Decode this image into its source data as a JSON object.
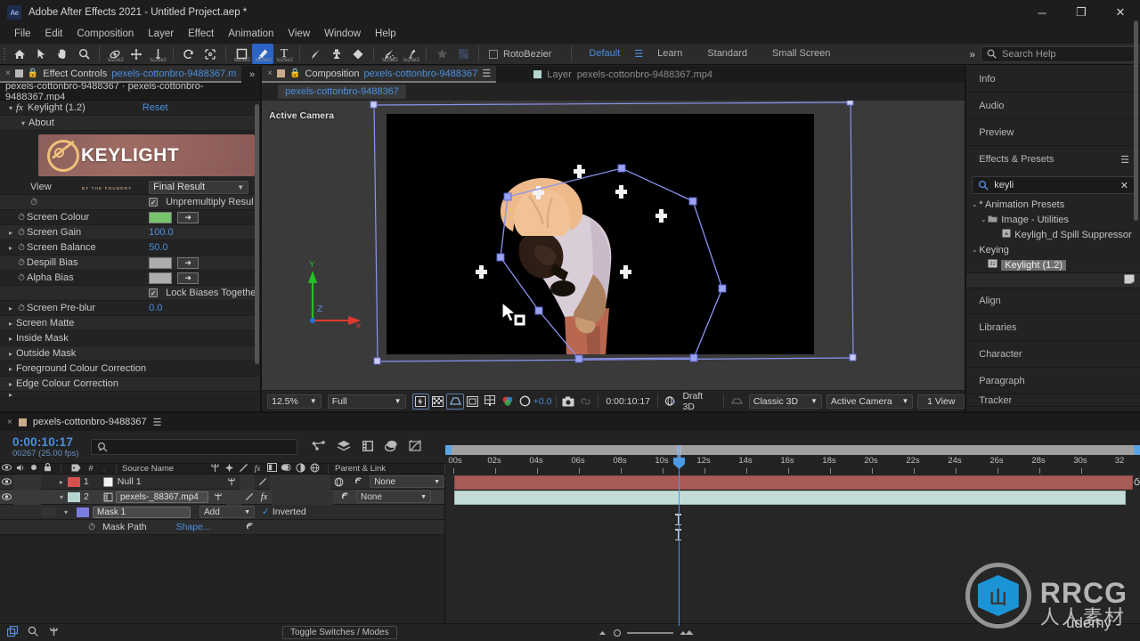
{
  "titlebar": {
    "logo": "Ae",
    "title": "Adobe After Effects 2021 - Untitled Project.aep *",
    "minimize": "─",
    "maximize": "❐",
    "close": "✕"
  },
  "menubar": {
    "items": [
      "File",
      "Edit",
      "Composition",
      "Layer",
      "Effect",
      "Animation",
      "View",
      "Window",
      "Help"
    ]
  },
  "toolbar": {
    "tools": [
      {
        "name": "home-icon",
        "glyph": "⌂"
      },
      {
        "name": "selection-tool",
        "glyph": "➤"
      },
      {
        "name": "hand-tool",
        "glyph": "✋"
      },
      {
        "name": "zoom-tool",
        "glyph": "⚲"
      },
      {
        "name": "orbit-tool",
        "glyph": "↻"
      },
      {
        "name": "pan-behind-tool",
        "glyph": "✥"
      },
      {
        "name": "dolly-tool",
        "glyph": "↓"
      },
      {
        "name": "rotation-tool",
        "glyph": "↺"
      },
      {
        "name": "anchor-point-tool",
        "glyph": "⬚"
      },
      {
        "name": "shape-tool",
        "glyph": "■"
      },
      {
        "name": "pen-tool",
        "glyph": "✒"
      },
      {
        "name": "type-tool",
        "glyph": "T"
      },
      {
        "name": "brush-tool",
        "glyph": "╱"
      },
      {
        "name": "clone-stamp-tool",
        "glyph": "⚓"
      },
      {
        "name": "eraser-tool",
        "glyph": "◆"
      },
      {
        "name": "roto-brush-tool",
        "glyph": "✐"
      },
      {
        "name": "puppet-pin-tool",
        "glyph": "✦"
      }
    ],
    "rotobezier_label": "RotoBezier",
    "workspaces": [
      "Default",
      "Learn",
      "Standard",
      "Small Screen"
    ],
    "workspace_selected": "Default",
    "chevron": "»",
    "search_help_placeholder": "Search Help",
    "search_icon": "search-icon"
  },
  "effect_controls": {
    "tab_label": "Effect Controls",
    "tab_file": "pexels-cottonbro-9488367.m",
    "subtitle": "pexels-cottonbro-9488367 · pexels-cottonbro-9488367.mp4",
    "more_chevron": "»",
    "effect_name": "Keylight (1.2)",
    "reset_label": "Reset",
    "about_label": "About",
    "banner_word": "KEYLIGHT",
    "banner_sub": "BY THE FOUNDRY",
    "rows": [
      {
        "label": "View",
        "type": "select",
        "value": "Final Result"
      },
      {
        "label": "",
        "type": "checkbox",
        "value": "Unpremultiply Resul",
        "checked": true
      },
      {
        "label": "Screen Colour",
        "type": "colorswatch",
        "color": "#77c46c"
      },
      {
        "label": "Screen Gain",
        "type": "number",
        "value": "100.0",
        "expandable": true
      },
      {
        "label": "Screen Balance",
        "type": "number",
        "value": "50.0",
        "expandable": true
      },
      {
        "label": "Despill Bias",
        "type": "colorswatch",
        "color": "#adadad"
      },
      {
        "label": "Alpha Bias",
        "type": "colorswatch",
        "color": "#adadad"
      },
      {
        "label": "",
        "type": "checkbox",
        "value": "Lock Biases Togethe",
        "checked": true
      },
      {
        "label": "Screen Pre-blur",
        "type": "number",
        "value": "0.0",
        "expandable": true
      },
      {
        "label": "Screen Matte",
        "type": "group"
      },
      {
        "label": "Inside Mask",
        "type": "group"
      },
      {
        "label": "Outside Mask",
        "type": "group"
      },
      {
        "label": "Foreground Colour Correction",
        "type": "group"
      },
      {
        "label": "Edge Colour Correction",
        "type": "group"
      }
    ]
  },
  "composition": {
    "tab_label": "Composition",
    "tab_file": "pexels-cottonbro-9488367",
    "layer_tab_label": "Layer",
    "layer_tab_file": "pexels-cottonbro-9488367.mp4",
    "comp_name_chip": "pexels-cottonbro-9488367",
    "active_camera_label": "Active Camera",
    "axis_x": "X",
    "axis_y": "Y",
    "axis_z": "Z",
    "bottom_bar": {
      "zoom": "12.5%",
      "resolution": "Full",
      "exposure": "+0.0",
      "timecode": "0:00:10:17",
      "draft3d": "Draft 3D",
      "renderer": "Classic 3D",
      "camera": "Active Camera",
      "views": "1 View"
    }
  },
  "right_panels": {
    "items": [
      "Info",
      "Audio",
      "Preview"
    ],
    "effects_presets_title": "Effects & Presets",
    "burger": "☰",
    "search_value": "keyli",
    "clear_icon": "✕",
    "tree": [
      {
        "depth": 0,
        "twirl": "⌄",
        "label": "* Animation Presets",
        "icon": null,
        "selected": false
      },
      {
        "depth": 1,
        "twirl": "⌄",
        "label": "Image - Utilities",
        "icon": "folder-icon",
        "selected": false
      },
      {
        "depth": 2,
        "twirl": "",
        "label": "Keyligh_d Spill Suppressor",
        "icon": "preset-icon",
        "selected": false
      },
      {
        "depth": 0,
        "twirl": "⌄",
        "label": "Keying",
        "icon": null,
        "selected": false
      },
      {
        "depth": 1,
        "twirl": "",
        "label": "Keylight (1.2)",
        "icon": "effect-32bit-icon",
        "selected": true
      }
    ],
    "bottom_items": [
      "Align",
      "Libraries",
      "Character",
      "Paragraph",
      "Tracker"
    ]
  },
  "timeline": {
    "tab_name": "pexels-cottonbro-9488367",
    "burger": "☰",
    "current_time": "0:00:10:17",
    "frame_info": "00267 (25.00 fps)",
    "search_icon": "search-icon",
    "search_value": "",
    "column_headers": {
      "video": "◉",
      "audio": "◑",
      "solo": "●",
      "lock": "ὑ2",
      "label": "label-icon",
      "num": "#",
      "source_name": "Source Name",
      "switches": "▣",
      "parent_link": "Parent & Link"
    },
    "layers": [
      {
        "index": "1",
        "name": "Null 1",
        "label_color": "#d4514e",
        "swatch": "#ffffff",
        "parent": "None",
        "selected": false,
        "has_fx": false,
        "bar_color": "#a95b58"
      },
      {
        "index": "2",
        "name": "pexels-_88367.mp4",
        "label_color": "#b6d7d1",
        "swatch": "#b6d7d1",
        "parent": "None",
        "selected": true,
        "has_fx": true,
        "bar_color": "#c3dcd8"
      }
    ],
    "mask": {
      "name": "Mask 1",
      "mode": "Add",
      "inverted_label": "Inverted",
      "inverted": true,
      "property": "Mask Path",
      "property_value": "Shape..."
    },
    "ruler_labels": [
      "00s",
      "02s",
      "04s",
      "06s",
      "08s",
      "10s",
      "12s",
      "14s",
      "16s",
      "18s",
      "20s",
      "22s",
      "24s",
      "26s",
      "28s",
      "30s",
      "32"
    ],
    "footer": {
      "toggle_switches": "Toggle Switches / Modes"
    }
  },
  "watermark": {
    "brand": "RRCG",
    "chinese": "人人素材",
    "udemy": "ûdemy",
    "mark": "山"
  }
}
